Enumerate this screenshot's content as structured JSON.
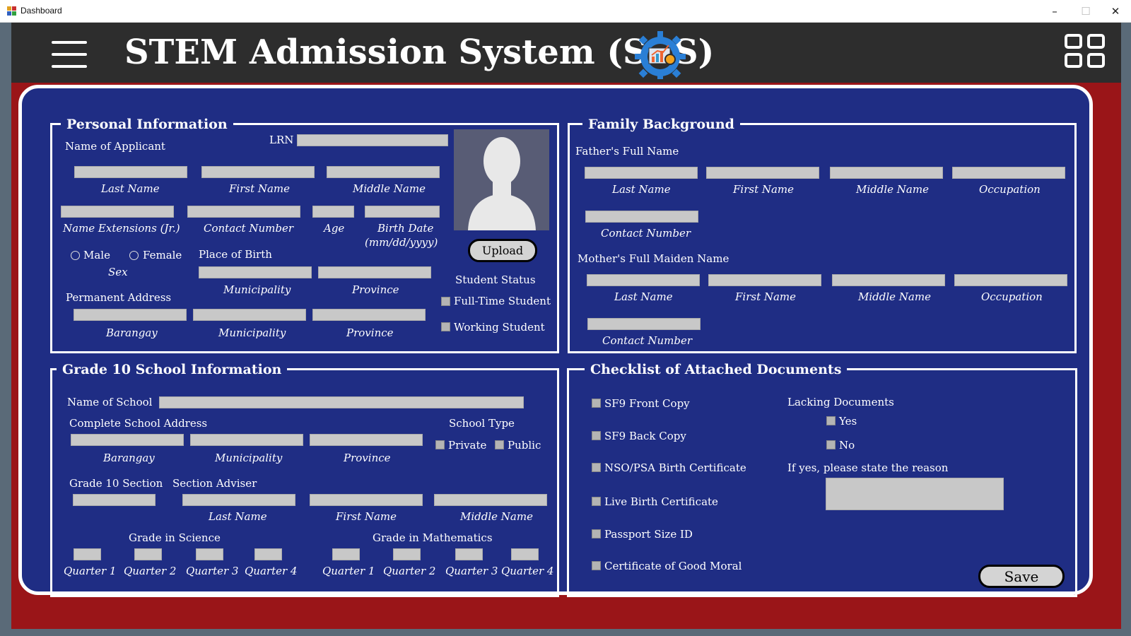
{
  "window": {
    "title": "Dashboard",
    "minimize": "–",
    "maximize": "☐",
    "close": "✕"
  },
  "header": {
    "title": "STEM Admission System (SAS)",
    "menu_icon": "hamburger-menu-icon",
    "logo_icon": "gear-chart-logo-icon",
    "apps_icon": "grid-apps-icon"
  },
  "colors": {
    "background": "#9a1518",
    "header": "#2d2d2d",
    "panel": "#1f2d84",
    "field": "#c8c8c8",
    "text": "#ffffff"
  },
  "personal": {
    "legend": "Personal Information",
    "name_of_applicant": "Name of Applicant",
    "lrn": "LRN",
    "last_name": "Last Name",
    "first_name": "First Name",
    "middle_name": "Middle Name",
    "name_ext": "Name Extensions (Jr.)",
    "contact": "Contact Number",
    "age": "Age",
    "birth_date_1": "Birth Date",
    "birth_date_2": "(mm/dd/yyyy)",
    "male": "Male",
    "female": "Female",
    "sex": "Sex",
    "place_of_birth": "Place of Birth",
    "pob_municipality": "Municipality",
    "pob_province": "Province",
    "permanent_address": "Permanent Address",
    "barangay": "Barangay",
    "municipality": "Municipality",
    "province": "Province",
    "upload": "Upload",
    "student_status": "Student Status",
    "full_time": "Full-Time Student",
    "working": "Working Student",
    "avatar_icon": "user-avatar-icon"
  },
  "family": {
    "legend": "Family Background",
    "father": "Father's Full Name",
    "mother": "Mother's Full Maiden Name",
    "last_name": "Last Name",
    "first_name": "First Name",
    "middle_name": "Middle Name",
    "occupation": "Occupation",
    "contact": "Contact Number"
  },
  "school": {
    "legend": "Grade 10 School Information",
    "name_of_school": "Name of School",
    "complete_address": "Complete School Address",
    "barangay": "Barangay",
    "municipality": "Municipality",
    "province": "Province",
    "school_type": "School Type",
    "private": "Private",
    "public": "Public",
    "section": "Grade 10 Section",
    "adviser": "Section Adviser",
    "last_name": "Last Name",
    "first_name": "First Name",
    "middle_name": "Middle Name",
    "grade_science": "Grade in Science",
    "grade_math": "Grade in Mathematics",
    "quarters": [
      "Quarter 1",
      "Quarter 2",
      "Quarter 3",
      "Quarter 4"
    ]
  },
  "checklist": {
    "legend": "Checklist of Attached Documents",
    "items": [
      "SF9 Front Copy",
      "SF9 Back Copy",
      "NSO/PSA Birth Certificate",
      "Live Birth Certificate",
      "Passport Size ID",
      "Certificate of Good Moral"
    ],
    "lacking": "Lacking Documents",
    "yes": "Yes",
    "no": "No",
    "reason": "If yes, please state the reason",
    "save": "Save"
  }
}
